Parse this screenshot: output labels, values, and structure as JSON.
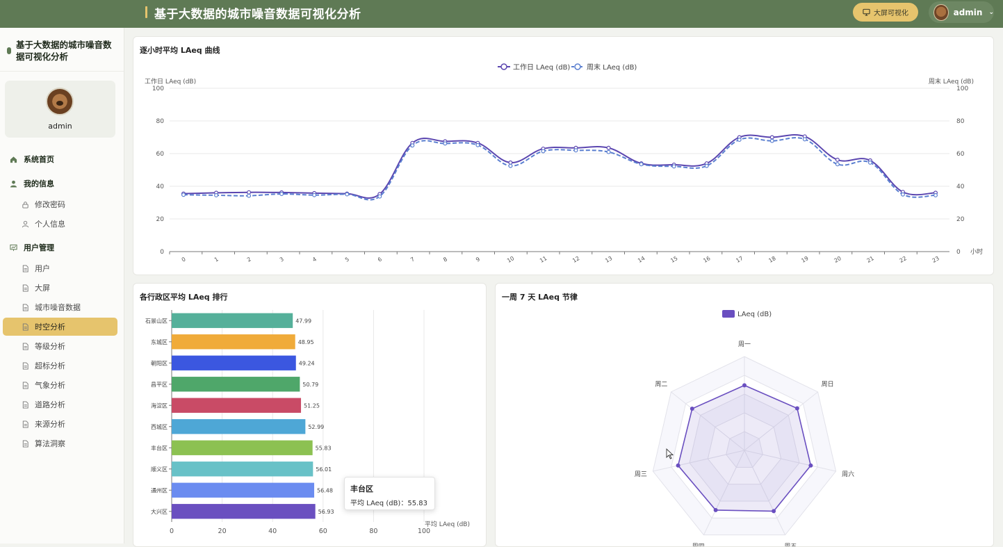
{
  "header": {
    "title": "基于大数据的城市噪音数据可视化分析",
    "bigscreen_label": "大屏可视化",
    "user": "admin"
  },
  "sidebar": {
    "brand": "基于大数据的城市噪音数据可视化分析",
    "profile_name": "admin",
    "items": [
      {
        "type": "group",
        "label": "系统首页",
        "icon": "home-icon"
      },
      {
        "type": "group",
        "label": "我的信息",
        "icon": "user-icon"
      },
      {
        "type": "sub",
        "label": "修改密码",
        "icon": "lock-icon"
      },
      {
        "type": "sub",
        "label": "个人信息",
        "icon": "person-icon"
      },
      {
        "type": "group",
        "label": "用户管理",
        "icon": "chart-board-icon"
      },
      {
        "type": "sub",
        "label": "用户",
        "icon": "document-icon"
      },
      {
        "type": "sub",
        "label": "大屏",
        "icon": "document-icon"
      },
      {
        "type": "sub",
        "label": "城市噪音数据",
        "icon": "document-icon"
      },
      {
        "type": "sub",
        "label": "时空分析",
        "icon": "document-icon",
        "active": true
      },
      {
        "type": "sub",
        "label": "等级分析",
        "icon": "document-icon"
      },
      {
        "type": "sub",
        "label": "超标分析",
        "icon": "document-icon"
      },
      {
        "type": "sub",
        "label": "气象分析",
        "icon": "document-icon"
      },
      {
        "type": "sub",
        "label": "道路分析",
        "icon": "document-icon"
      },
      {
        "type": "sub",
        "label": "来源分析",
        "icon": "document-icon"
      },
      {
        "type": "sub",
        "label": "算法洞察",
        "icon": "document-icon"
      }
    ]
  },
  "cards": {
    "hourly": {
      "title": "逐小时平均 LAeq 曲线"
    },
    "district": {
      "title": "各行政区平均 LAeq 排行"
    },
    "weekly": {
      "title": "一周 7 天 LAeq 节律"
    }
  },
  "tooltip": {
    "name": "丰台区",
    "line": "平均 LAeq (dB)：55.83"
  },
  "colors": {
    "header": "#5f7a55",
    "accent": "#e6c46d",
    "line_work": "#5b46b0",
    "line_weekend": "#5a7fd0",
    "radar": "#6a4fc0"
  },
  "chart_data": [
    {
      "type": "line",
      "title": "逐小时平均 LAeq 曲线",
      "x": [
        "0",
        "1",
        "2",
        "3",
        "4",
        "5",
        "6",
        "7",
        "8",
        "9",
        "10",
        "11",
        "12",
        "13",
        "14",
        "15",
        "16",
        "17",
        "18",
        "19",
        "20",
        "21",
        "22",
        "23"
      ],
      "xlabel": "小时",
      "ylabel_left": "工作日 LAeq (dB)",
      "ylabel_right": "周末 LAeq (dB)",
      "ylim": [
        0,
        100
      ],
      "yticks": [
        0,
        20,
        40,
        60,
        80,
        100
      ],
      "legend": "top-center",
      "series": [
        {
          "name": "工作日 LAeq (dB)",
          "style": "solid",
          "values": [
            35.5,
            36,
            36.3,
            36.2,
            35.8,
            35.5,
            35.2,
            66.5,
            67.5,
            66.5,
            54.5,
            63,
            63.5,
            63.5,
            54,
            53.2,
            54,
            70,
            70,
            70.5,
            56.2,
            55.8,
            36.5,
            36
          ]
        },
        {
          "name": "周末 LAeq (dB)",
          "style": "dashed",
          "values": [
            34.8,
            34.5,
            34.2,
            35.3,
            34.6,
            35.1,
            33.8,
            65,
            66.2,
            65.2,
            52.5,
            61.5,
            62,
            61,
            53.5,
            52.2,
            52.5,
            68.5,
            67.8,
            68.8,
            53.5,
            54.5,
            35,
            34.5
          ]
        }
      ]
    },
    {
      "type": "bar",
      "orientation": "horizontal",
      "title": "各行政区平均 LAeq 排行",
      "categories": [
        "石景山区",
        "东城区",
        "朝阳区",
        "昌平区",
        "海淀区",
        "西城区",
        "丰台区",
        "顺义区",
        "通州区",
        "大兴区"
      ],
      "values": [
        47.99,
        48.95,
        49.24,
        50.79,
        51.25,
        52.99,
        55.83,
        56.01,
        56.48,
        56.93
      ],
      "bar_colors": [
        "#55b09a",
        "#f0ab3a",
        "#3b57e0",
        "#4fa76a",
        "#c94b66",
        "#4ea7d6",
        "#8cc152",
        "#68c1c7",
        "#6b8cf0",
        "#6a4fc0"
      ],
      "xlabel": "平均 LAeq (dB)",
      "xlim": [
        0,
        100
      ],
      "xticks": [
        0,
        20,
        40,
        60,
        80,
        100
      ]
    },
    {
      "type": "radar",
      "title": "一周 7 天 LAeq 节律",
      "categories": [
        "周一",
        "周日",
        "周六",
        "周五",
        "周四",
        "周三",
        "周二"
      ],
      "values": [
        55.5,
        57.5,
        58,
        57.5,
        56.5,
        58,
        57
      ],
      "max": 80,
      "series_name": "LAeq (dB)",
      "legend": "top-center"
    }
  ]
}
